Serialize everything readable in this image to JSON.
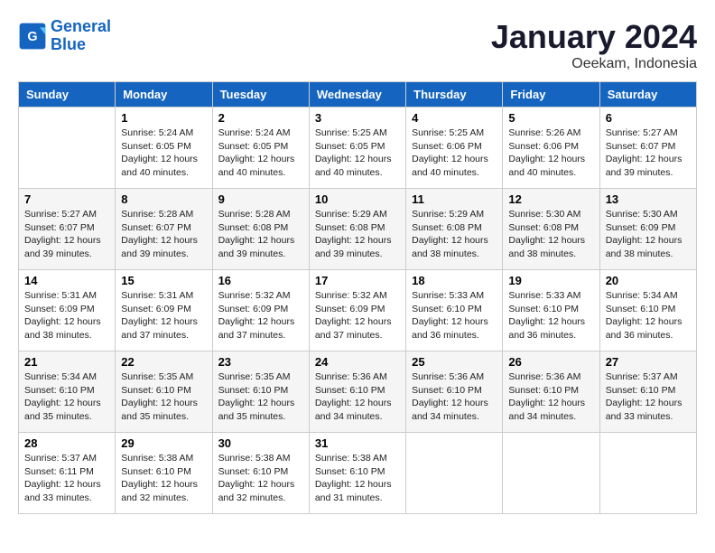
{
  "header": {
    "logo_line1": "General",
    "logo_line2": "Blue",
    "month": "January 2024",
    "location": "Oeekam, Indonesia"
  },
  "weekdays": [
    "Sunday",
    "Monday",
    "Tuesday",
    "Wednesday",
    "Thursday",
    "Friday",
    "Saturday"
  ],
  "weeks": [
    [
      {
        "day": "",
        "info": ""
      },
      {
        "day": "1",
        "info": "Sunrise: 5:24 AM\nSunset: 6:05 PM\nDaylight: 12 hours\nand 40 minutes."
      },
      {
        "day": "2",
        "info": "Sunrise: 5:24 AM\nSunset: 6:05 PM\nDaylight: 12 hours\nand 40 minutes."
      },
      {
        "day": "3",
        "info": "Sunrise: 5:25 AM\nSunset: 6:05 PM\nDaylight: 12 hours\nand 40 minutes."
      },
      {
        "day": "4",
        "info": "Sunrise: 5:25 AM\nSunset: 6:06 PM\nDaylight: 12 hours\nand 40 minutes."
      },
      {
        "day": "5",
        "info": "Sunrise: 5:26 AM\nSunset: 6:06 PM\nDaylight: 12 hours\nand 40 minutes."
      },
      {
        "day": "6",
        "info": "Sunrise: 5:27 AM\nSunset: 6:07 PM\nDaylight: 12 hours\nand 39 minutes."
      }
    ],
    [
      {
        "day": "7",
        "info": "Sunrise: 5:27 AM\nSunset: 6:07 PM\nDaylight: 12 hours\nand 39 minutes."
      },
      {
        "day": "8",
        "info": "Sunrise: 5:28 AM\nSunset: 6:07 PM\nDaylight: 12 hours\nand 39 minutes."
      },
      {
        "day": "9",
        "info": "Sunrise: 5:28 AM\nSunset: 6:08 PM\nDaylight: 12 hours\nand 39 minutes."
      },
      {
        "day": "10",
        "info": "Sunrise: 5:29 AM\nSunset: 6:08 PM\nDaylight: 12 hours\nand 39 minutes."
      },
      {
        "day": "11",
        "info": "Sunrise: 5:29 AM\nSunset: 6:08 PM\nDaylight: 12 hours\nand 38 minutes."
      },
      {
        "day": "12",
        "info": "Sunrise: 5:30 AM\nSunset: 6:08 PM\nDaylight: 12 hours\nand 38 minutes."
      },
      {
        "day": "13",
        "info": "Sunrise: 5:30 AM\nSunset: 6:09 PM\nDaylight: 12 hours\nand 38 minutes."
      }
    ],
    [
      {
        "day": "14",
        "info": "Sunrise: 5:31 AM\nSunset: 6:09 PM\nDaylight: 12 hours\nand 38 minutes."
      },
      {
        "day": "15",
        "info": "Sunrise: 5:31 AM\nSunset: 6:09 PM\nDaylight: 12 hours\nand 37 minutes."
      },
      {
        "day": "16",
        "info": "Sunrise: 5:32 AM\nSunset: 6:09 PM\nDaylight: 12 hours\nand 37 minutes."
      },
      {
        "day": "17",
        "info": "Sunrise: 5:32 AM\nSunset: 6:09 PM\nDaylight: 12 hours\nand 37 minutes."
      },
      {
        "day": "18",
        "info": "Sunrise: 5:33 AM\nSunset: 6:10 PM\nDaylight: 12 hours\nand 36 minutes."
      },
      {
        "day": "19",
        "info": "Sunrise: 5:33 AM\nSunset: 6:10 PM\nDaylight: 12 hours\nand 36 minutes."
      },
      {
        "day": "20",
        "info": "Sunrise: 5:34 AM\nSunset: 6:10 PM\nDaylight: 12 hours\nand 36 minutes."
      }
    ],
    [
      {
        "day": "21",
        "info": "Sunrise: 5:34 AM\nSunset: 6:10 PM\nDaylight: 12 hours\nand 35 minutes."
      },
      {
        "day": "22",
        "info": "Sunrise: 5:35 AM\nSunset: 6:10 PM\nDaylight: 12 hours\nand 35 minutes."
      },
      {
        "day": "23",
        "info": "Sunrise: 5:35 AM\nSunset: 6:10 PM\nDaylight: 12 hours\nand 35 minutes."
      },
      {
        "day": "24",
        "info": "Sunrise: 5:36 AM\nSunset: 6:10 PM\nDaylight: 12 hours\nand 34 minutes."
      },
      {
        "day": "25",
        "info": "Sunrise: 5:36 AM\nSunset: 6:10 PM\nDaylight: 12 hours\nand 34 minutes."
      },
      {
        "day": "26",
        "info": "Sunrise: 5:36 AM\nSunset: 6:10 PM\nDaylight: 12 hours\nand 34 minutes."
      },
      {
        "day": "27",
        "info": "Sunrise: 5:37 AM\nSunset: 6:10 PM\nDaylight: 12 hours\nand 33 minutes."
      }
    ],
    [
      {
        "day": "28",
        "info": "Sunrise: 5:37 AM\nSunset: 6:11 PM\nDaylight: 12 hours\nand 33 minutes."
      },
      {
        "day": "29",
        "info": "Sunrise: 5:38 AM\nSunset: 6:10 PM\nDaylight: 12 hours\nand 32 minutes."
      },
      {
        "day": "30",
        "info": "Sunrise: 5:38 AM\nSunset: 6:10 PM\nDaylight: 12 hours\nand 32 minutes."
      },
      {
        "day": "31",
        "info": "Sunrise: 5:38 AM\nSunset: 6:10 PM\nDaylight: 12 hours\nand 31 minutes."
      },
      {
        "day": "",
        "info": ""
      },
      {
        "day": "",
        "info": ""
      },
      {
        "day": "",
        "info": ""
      }
    ]
  ]
}
